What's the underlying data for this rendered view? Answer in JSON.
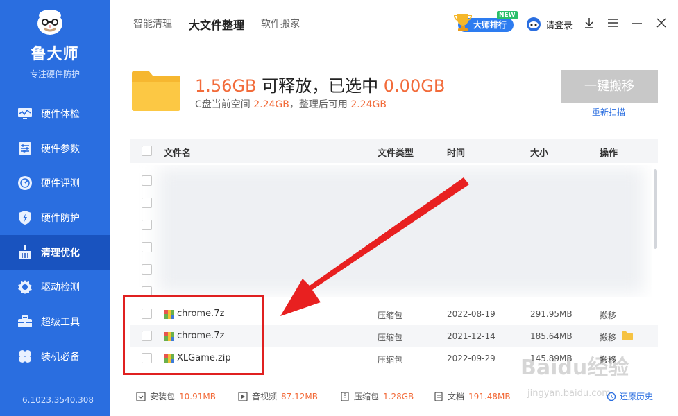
{
  "sidebar": {
    "app_name": "鲁大师",
    "tagline": "专注硬件防护",
    "items": [
      {
        "label": "硬件体检",
        "icon": "monitor-icon"
      },
      {
        "label": "硬件参数",
        "icon": "sliders-icon"
      },
      {
        "label": "硬件评测",
        "icon": "gauge-icon"
      },
      {
        "label": "硬件防护",
        "icon": "shield-icon"
      },
      {
        "label": "清理优化",
        "icon": "broom-icon",
        "active": true
      },
      {
        "label": "驱动检测",
        "icon": "gear-icon"
      },
      {
        "label": "超级工具",
        "icon": "toolbox-icon"
      },
      {
        "label": "装机必备",
        "icon": "clover-icon"
      }
    ],
    "version": "6.1023.3540.308"
  },
  "topbar": {
    "tabs": [
      {
        "label": "智能清理"
      },
      {
        "label": "大文件整理",
        "active": true
      },
      {
        "label": "软件搬家"
      }
    ],
    "master_ranking": "大师排行",
    "new_badge": "NEW",
    "login": "请登录"
  },
  "summary": {
    "releasable": "1.56GB",
    "releasable_text": "可释放，已选中",
    "selected": "0.00GB",
    "space_label": "C盘当前空间",
    "space_value": "2.24GB",
    "after_label": "，整理后可用",
    "after_value": "2.24GB",
    "move_all_button": "一键搬移",
    "rescan_link": "重新扫描"
  },
  "table": {
    "headers": {
      "name": "文件名",
      "type": "文件类型",
      "time": "时间",
      "size": "大小",
      "action": "操作"
    },
    "rows": [
      {
        "name": "chrome.7z",
        "type": "压缩包",
        "time": "2022-08-19",
        "size": "291.95MB",
        "action": "搬移"
      },
      {
        "name": "chrome.7z",
        "type": "压缩包",
        "time": "2021-12-14",
        "size": "185.64MB",
        "action": "搬移"
      },
      {
        "name": "XLGame.zip",
        "type": "压缩包",
        "time": "2022-09-29",
        "size": "145.89MB",
        "action": "搬移"
      }
    ]
  },
  "footer": {
    "items": [
      {
        "label": "安装包",
        "value": "10.91MB"
      },
      {
        "label": "音视频",
        "value": "87.12MB"
      },
      {
        "label": "压缩包",
        "value": "1.28GB"
      },
      {
        "label": "文档",
        "value": "191.48MB"
      }
    ],
    "restore_link": "还原历史"
  },
  "watermark": {
    "logo": "Baidu经验",
    "url": "jingyan.baidu.com"
  },
  "colors": {
    "sidebar": "#2a6ee0",
    "sidebar_active": "#1953bf",
    "accent_orange": "#f26b3a",
    "link_blue": "#2a6ee0",
    "highlight_red": "#e02020"
  }
}
